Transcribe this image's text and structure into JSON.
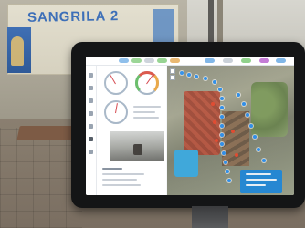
{
  "banner": {
    "text": "SANGRILA 2"
  },
  "colors": {
    "banner_text": "#3d6fb8",
    "tablet_bezel": "#141516",
    "map_route": "#2f8ee8",
    "map_popup": "#1f86d6"
  }
}
